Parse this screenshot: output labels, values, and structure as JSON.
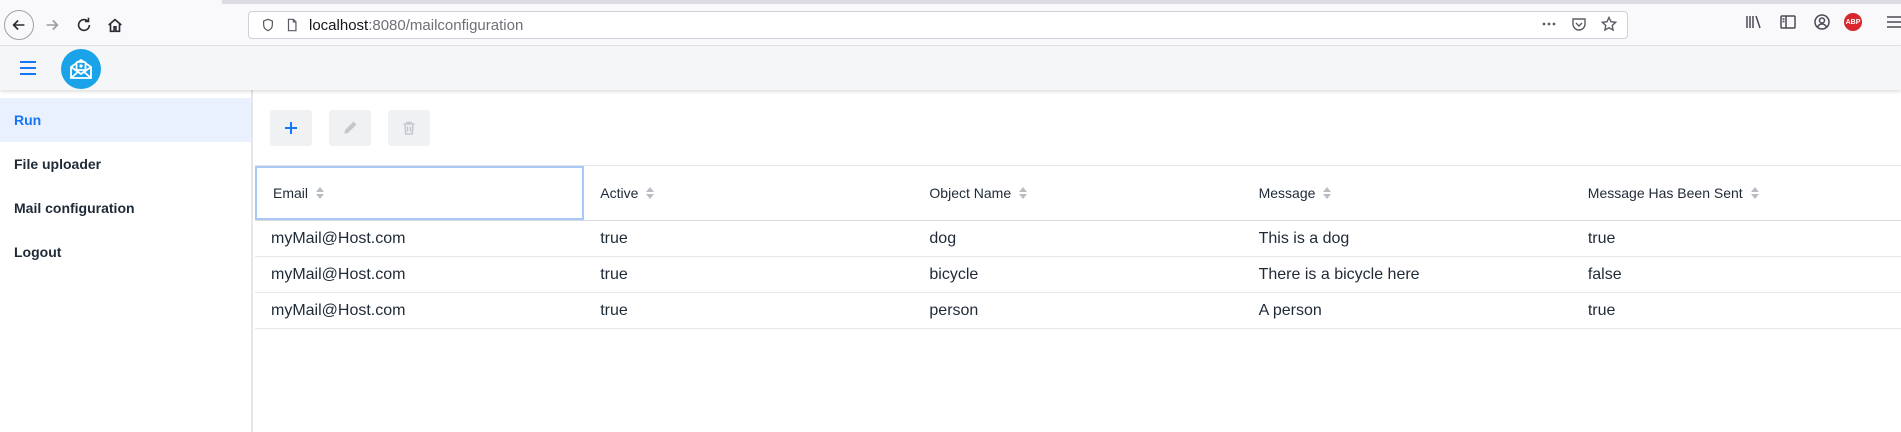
{
  "browser": {
    "url_host": "localhost",
    "url_path": ":8080/mailconfiguration"
  },
  "sidebar": {
    "items": [
      {
        "label": "Run"
      },
      {
        "label": "File uploader"
      },
      {
        "label": "Mail configuration"
      },
      {
        "label": "Logout"
      }
    ]
  },
  "toolbar": {
    "add_icon": "plus-icon",
    "edit_icon": "pencil-icon",
    "delete_icon": "trash-icon"
  },
  "grid": {
    "columns": [
      "Email",
      "Active",
      "Object Name",
      "Message",
      "Message Has Been Sent"
    ],
    "rows": [
      [
        "myMail@Host.com",
        "true",
        "dog",
        "This is a dog",
        "true"
      ],
      [
        "myMail@Host.com",
        "true",
        "bicycle",
        "There is a bicycle here",
        "false"
      ],
      [
        "myMail@Host.com",
        "true",
        "person",
        "A person",
        "true"
      ]
    ]
  },
  "colors": {
    "accent": "#1676f3",
    "logo": "#1aa3e8",
    "active_bg": "#e8f1fd"
  }
}
